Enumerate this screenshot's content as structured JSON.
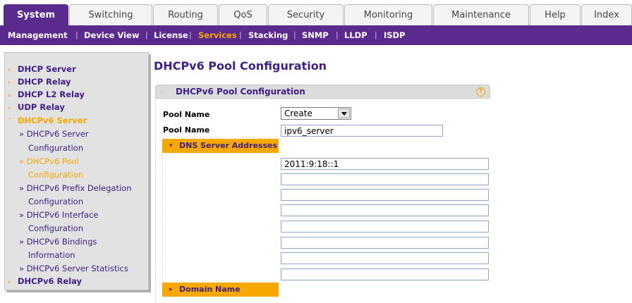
{
  "top_tabs": [
    {
      "label": "System",
      "active": true
    },
    {
      "label": "Switching",
      "active": false
    },
    {
      "label": "Routing",
      "active": false
    },
    {
      "label": "QoS",
      "active": false
    },
    {
      "label": "Security",
      "active": false
    },
    {
      "label": "Monitoring",
      "active": false
    },
    {
      "label": "Maintenance",
      "active": false
    },
    {
      "label": "Help",
      "active": false
    },
    {
      "label": "Index",
      "active": false
    }
  ],
  "sub_nav": [
    {
      "label": "Management",
      "active": false
    },
    {
      "label": "Device View",
      "active": false
    },
    {
      "label": "License",
      "active": false
    },
    {
      "label": "Services",
      "active": true
    },
    {
      "label": "Stacking",
      "active": false
    },
    {
      "label": "SNMP",
      "active": false
    },
    {
      "label": "LLDP",
      "active": false
    },
    {
      "label": "ISDP",
      "active": false
    }
  ],
  "sidebar": {
    "items": [
      {
        "label": "DHCP Server"
      },
      {
        "label": "DHCP Relay"
      },
      {
        "label": "DHCP L2 Relay"
      },
      {
        "label": "UDP Relay"
      },
      {
        "label": "DHCPv6 Server"
      },
      {
        "label": "DHCPv6 Relay"
      }
    ],
    "arrow_closed": "›",
    "arrow_open": "˅",
    "sub_lines": [
      "» DHCPv6 Server",
      "Configuration",
      "» DHCPv6 Pool",
      "Configuration",
      "» DHCPv6 Prefix Delegation",
      "Configuration",
      "» DHCPv6 Interface",
      "Configuration",
      "» DHCPv6 Bindings",
      "Information",
      "» DHCPv6 Server Statistics"
    ]
  },
  "main": {
    "page_title": "DHCPv6 Pool Configuration",
    "panel_title": "DHCPv6 Pool Configuration",
    "help_glyph": "?",
    "grip": "::",
    "pool_name_select_label": "Pool Name",
    "pool_name_select_value": "Create",
    "pool_name_input_label": "Pool Name",
    "pool_name_input_value": "ipv6_server",
    "dns_section_label": "DNS Server Addresses",
    "dns_arrow": "▾",
    "dns_servers": [
      "2011:9:18::1",
      "",
      "",
      "",
      "",
      "",
      "",
      ""
    ],
    "domain_section_label": "Domain Name",
    "domain_arrow": "▸"
  },
  "colors": {
    "brand_purple": "#5a2a8f",
    "accent_orange": "#f7a800",
    "text_purple": "#3f1f86"
  }
}
